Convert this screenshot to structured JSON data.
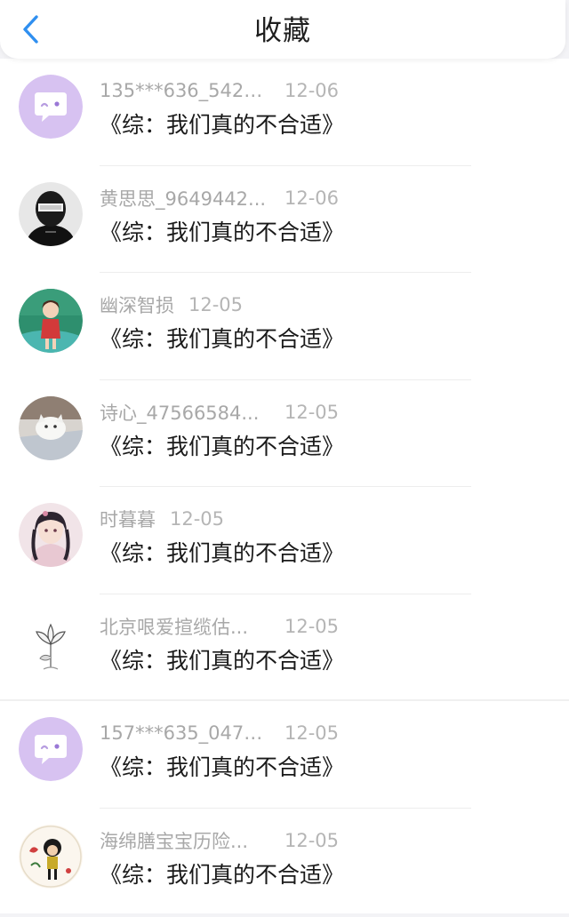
{
  "header": {
    "title": "收藏",
    "back_icon": "chevron-left-icon",
    "accent_color": "#2f8ff0"
  },
  "items": [
    {
      "name": "135***636_5420...",
      "date": "12-06",
      "content": "《综：我们真的不合适》",
      "avatar": "purple-chat-bubble"
    },
    {
      "name": "黄思思_9649442...",
      "date": "12-06",
      "content": "《综：我们真的不合适》",
      "avatar": "girl-dark-portrait"
    },
    {
      "name": "幽深智损",
      "date": "12-05",
      "content": "《综：我们真的不合适》",
      "avatar": "anime-girl-green"
    },
    {
      "name": "诗心_47566584...",
      "date": "12-05",
      "content": "《综：我们真的不合适》",
      "avatar": "white-cat"
    },
    {
      "name": "时暮暮",
      "date": "12-05",
      "content": "《综：我们真的不合适》",
      "avatar": "anime-girl-pink"
    },
    {
      "name": "北京哏爱揎缆估...",
      "date": "12-05",
      "content": "《综：我们真的不合适》",
      "avatar": "lotus-sketch"
    },
    {
      "name": "157***635_0476...",
      "date": "12-05",
      "content": "《综：我们真的不合适》",
      "avatar": "purple-chat-bubble"
    },
    {
      "name": "海绵膳宝宝历险...",
      "date": "12-05",
      "content": "《综：我们真的不合适》",
      "avatar": "cartoon-doll"
    }
  ]
}
